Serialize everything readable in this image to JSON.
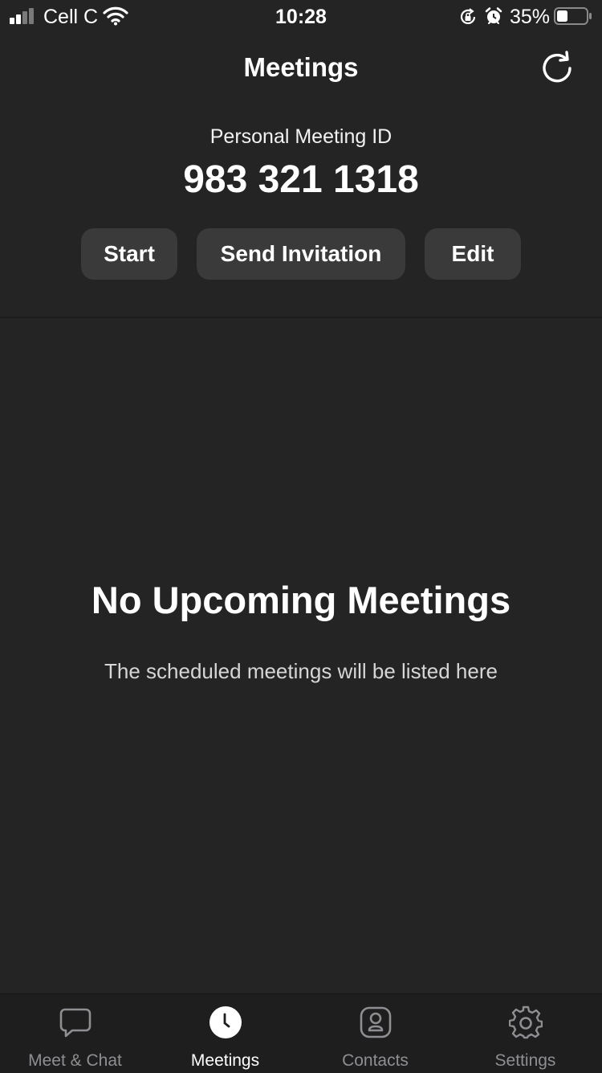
{
  "status_bar": {
    "carrier": "Cell C",
    "time": "10:28",
    "battery_percent": "35%",
    "icons": [
      "signal-icon",
      "wifi-icon",
      "orientation-lock-icon",
      "alarm-icon",
      "battery-icon"
    ]
  },
  "header": {
    "title": "Meetings",
    "refresh_icon": "refresh-icon"
  },
  "personal_meeting": {
    "label": "Personal Meeting ID",
    "id": "983 321 1318",
    "buttons": {
      "start": "Start",
      "send_invitation": "Send Invitation",
      "edit": "Edit"
    }
  },
  "empty_state": {
    "title": "No Upcoming Meetings",
    "subtitle": "The scheduled meetings will be listed here"
  },
  "tab_bar": {
    "items": [
      {
        "label": "Meet & Chat",
        "icon": "chat-bubble-icon",
        "active": false
      },
      {
        "label": "Meetings",
        "icon": "clock-icon",
        "active": true
      },
      {
        "label": "Contacts",
        "icon": "contact-icon",
        "active": false
      },
      {
        "label": "Settings",
        "icon": "gear-icon",
        "active": false
      }
    ]
  },
  "colors": {
    "background": "#242424",
    "button": "#3a3a3a",
    "tab_bar": "#1e1e1e",
    "tab_active": "#ffffff",
    "tab_inactive": "#8e8e93"
  }
}
